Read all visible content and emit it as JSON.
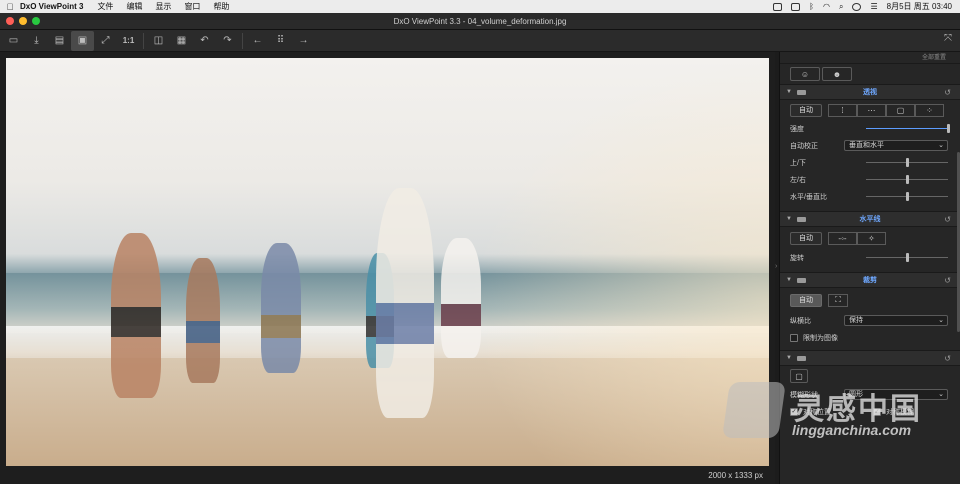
{
  "menubar": {
    "app_name": "DxO ViewPoint 3",
    "items": [
      "文件",
      "编辑",
      "显示",
      "窗口",
      "帮助"
    ],
    "date_time": "8月5日 周五 03:40"
  },
  "window": {
    "title": "DxO ViewPoint 3.3 - 04_volume_deformation.jpg"
  },
  "toolbar": {
    "zoom_label": "1:1"
  },
  "viewer": {
    "image_size": "2000 x 1333 px"
  },
  "panel": {
    "top_link": "全部重置",
    "perspective": {
      "title": "透视",
      "auto_label": "自动",
      "strength_label": "强度",
      "strength_value": 1.0,
      "auto_correct_label": "自动校正",
      "auto_correct_value": "垂直和水平",
      "updown_label": "上/下",
      "updown_value": 0.5,
      "leftright_label": "左/右",
      "leftright_value": 0.5,
      "ratio_label": "水平/垂直比",
      "ratio_value": 0.5
    },
    "horizon": {
      "title": "水平线",
      "auto_label": "自动",
      "rotate_label": "旋转",
      "rotate_value": 0.5
    },
    "crop": {
      "title": "裁剪",
      "auto_label": "自动",
      "aspect_label": "纵横比",
      "aspect_value": "保持",
      "limit_label": "限制为图像"
    },
    "blur": {
      "shape_label": "模糊形状",
      "shape_value": "圆形",
      "sym_pos_label": "对称位置",
      "sym_blur_label": "对称模糊"
    }
  },
  "watermark": {
    "cn": "灵感中国",
    "en": "lingganchina.com"
  }
}
